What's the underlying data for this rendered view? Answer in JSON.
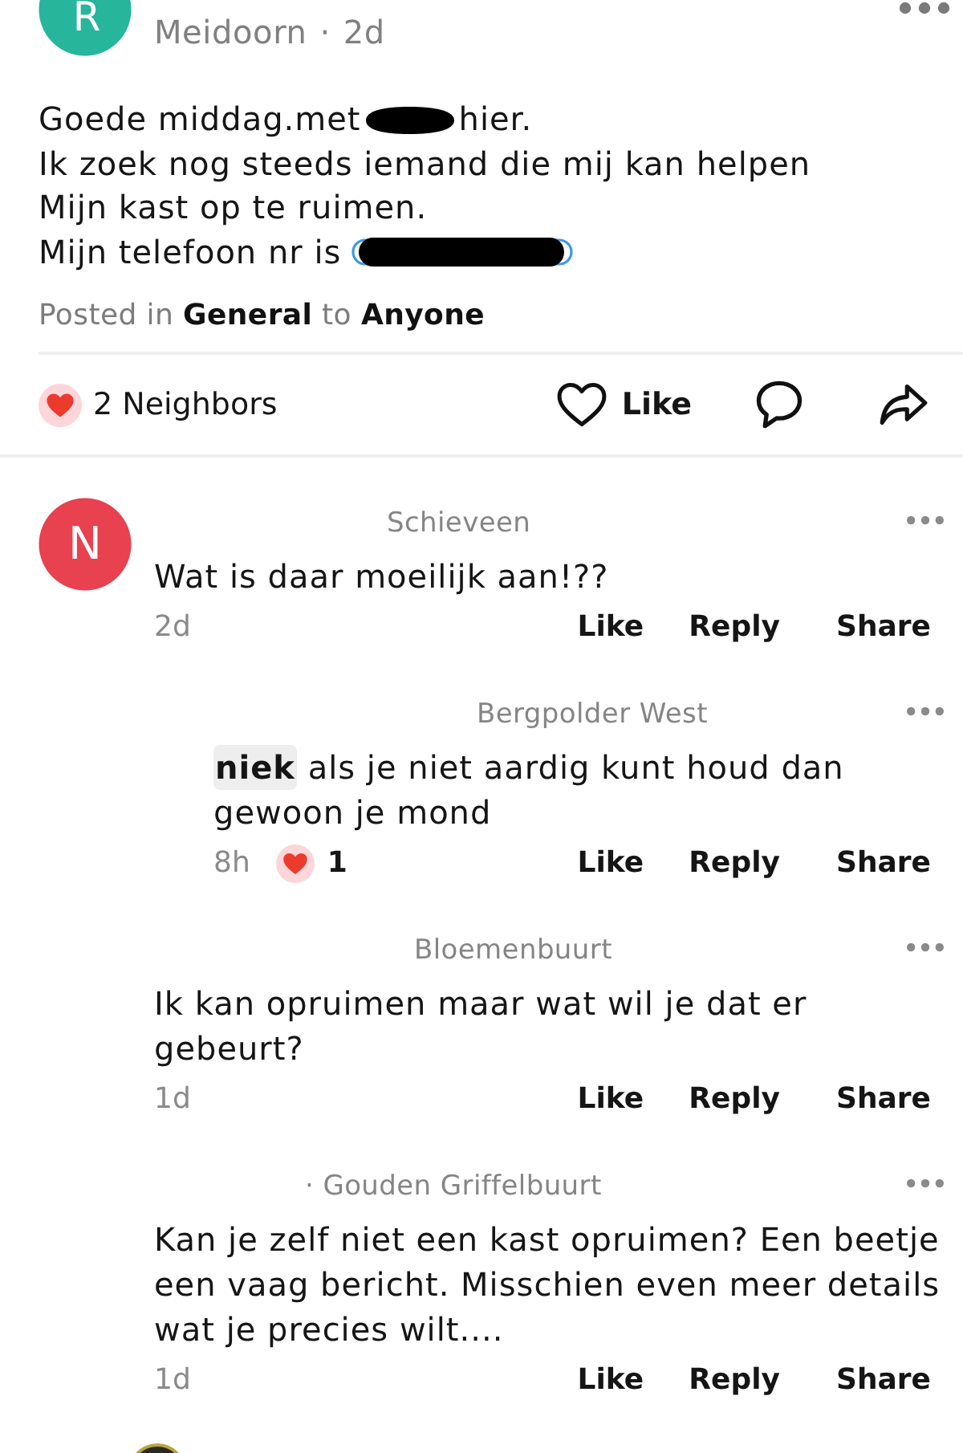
{
  "post": {
    "avatar": {
      "kind": "letter",
      "letter": "R",
      "color": "#27b59c"
    },
    "neighborhood": "Meidoorn",
    "separator": "·",
    "time": "2d",
    "body": [
      [
        {
          "kind": "text",
          "text": "Goede middag.met"
        },
        {
          "kind": "redaction"
        },
        {
          "kind": "text",
          "text": "hier."
        }
      ],
      [
        {
          "kind": "text",
          "text": "Ik zoek nog steeds iemand die mij kan helpen"
        }
      ],
      [
        {
          "kind": "text",
          "text": "Mijn kast op te ruimen."
        }
      ],
      [
        {
          "kind": "text",
          "text": "Mijn telefoon nr is"
        },
        {
          "kind": "redacted_link"
        }
      ]
    ],
    "posted_in": "Posted in **General** to **Anyone**"
  },
  "reactions": {
    "label": "2 Neighbors"
  },
  "post_actions": [
    {
      "kind": "like",
      "label": "Like"
    },
    {
      "kind": "comment"
    },
    {
      "kind": "share"
    }
  ],
  "comments": [
    {
      "avatar": {
        "kind": "letter",
        "letter": "N",
        "color": "#e8414f"
      },
      "neighborhood": "Schieveen",
      "text": "Wat is daar moeilijk aan!??",
      "time": "2d",
      "actions": [
        "Like",
        "Reply",
        "Share"
      ],
      "replies": [
        {
          "neighborhood": "Bergpolder West",
          "mention": "niek",
          "text": "als je niet aardig kunt houd dan gewoon je mond",
          "time": "8h",
          "reaction_count": "1",
          "actions": [
            "Like",
            "Reply",
            "Share"
          ]
        }
      ]
    },
    {
      "neighborhood": "Bloemenbuurt",
      "text": "Ik kan opruimen maar wat wil je dat er gebeurt?",
      "time": "1d",
      "actions": [
        "Like",
        "Reply",
        "Share"
      ]
    },
    {
      "neighborhood": "· Gouden Griffelbuurt",
      "text": "Kan je zelf niet een kast opruimen? Een beetje een vaag bericht. Misschien even meer details wat je precies wilt....",
      "time": "1d",
      "actions": [
        "Like",
        "Reply",
        "Share"
      ]
    }
  ],
  "next_comment": {
    "avatar": {
      "kind": "photo"
    }
  }
}
